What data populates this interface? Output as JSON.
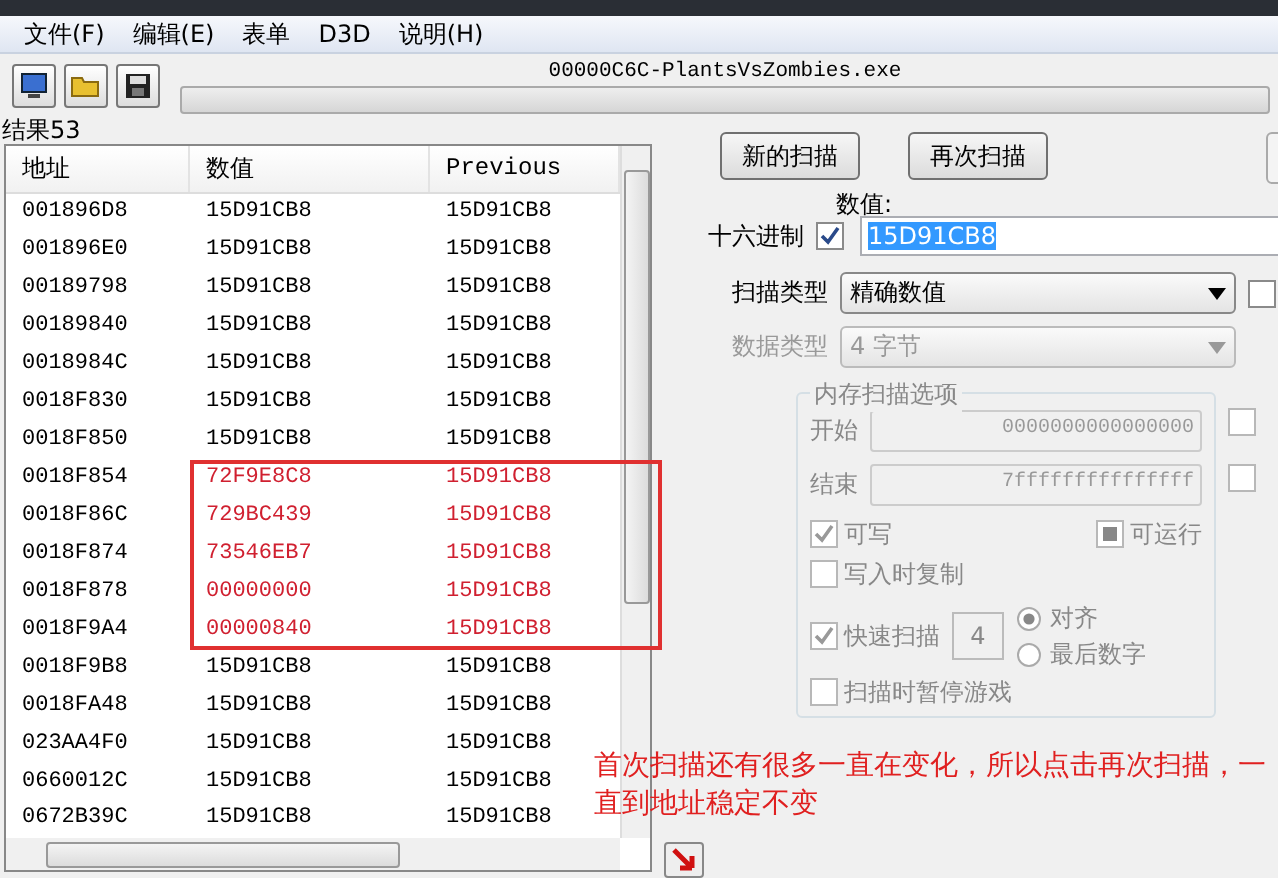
{
  "menu": [
    {
      "label": "文件(F)"
    },
    {
      "label": "编辑(E)"
    },
    {
      "label": "表单"
    },
    {
      "label": "D3D"
    },
    {
      "label": "说明(H)"
    }
  ],
  "toolbar": {
    "process": "00000C6C-PlantsVsZombies.exe",
    "level": 0
  },
  "results": {
    "count_label": "结果53",
    "columns": [
      "地址",
      "数值",
      "Previous"
    ],
    "rows": [
      {
        "address": "001896D8",
        "value": "15D91CB8",
        "previous": "15D91CB8",
        "changed": false
      },
      {
        "address": "001896E0",
        "value": "15D91CB8",
        "previous": "15D91CB8",
        "changed": false
      },
      {
        "address": "00189798",
        "value": "15D91CB8",
        "previous": "15D91CB8",
        "changed": false
      },
      {
        "address": "00189840",
        "value": "15D91CB8",
        "previous": "15D91CB8",
        "changed": false
      },
      {
        "address": "0018984C",
        "value": "15D91CB8",
        "previous": "15D91CB8",
        "changed": false
      },
      {
        "address": "0018F830",
        "value": "15D91CB8",
        "previous": "15D91CB8",
        "changed": false
      },
      {
        "address": "0018F850",
        "value": "15D91CB8",
        "previous": "15D91CB8",
        "changed": false
      },
      {
        "address": "0018F854",
        "value": "72F9E8C8",
        "previous": "15D91CB8",
        "changed": true
      },
      {
        "address": "0018F86C",
        "value": "729BC439",
        "previous": "15D91CB8",
        "changed": true
      },
      {
        "address": "0018F874",
        "value": "73546EB7",
        "previous": "15D91CB8",
        "changed": true
      },
      {
        "address": "0018F878",
        "value": "00000000",
        "previous": "15D91CB8",
        "changed": true
      },
      {
        "address": "0018F9A4",
        "value": "00000840",
        "previous": "15D91CB8",
        "changed": true
      },
      {
        "address": "0018F9B8",
        "value": "15D91CB8",
        "previous": "15D91CB8",
        "changed": false
      },
      {
        "address": "0018FA48",
        "value": "15D91CB8",
        "previous": "15D91CB8",
        "changed": false
      },
      {
        "address": "023AA4F0",
        "value": "15D91CB8",
        "previous": "15D91CB8",
        "changed": false
      },
      {
        "address": "0660012C",
        "value": "15D91CB8",
        "previous": "15D91CB8",
        "changed": false
      },
      {
        "address": "0672B39C",
        "value": "15D91CB8",
        "previous": "15D91CB8",
        "changed": false
      }
    ]
  },
  "scan": {
    "buttons": [
      {
        "label": "新的扫描"
      },
      {
        "label": "再次扫描"
      }
    ],
    "value_label": "数值:",
    "hex": {
      "label": "十六进制",
      "checked": true
    },
    "value": "15D91CB8",
    "scan_type": {
      "label": "扫描类型",
      "value": "精确数值",
      "side_checked": false
    },
    "data_type": {
      "label": "数据类型",
      "value": "4 字节"
    },
    "options": {
      "title": "内存扫描选项",
      "disabled": true,
      "start_label": "开始",
      "start": "0000000000000000",
      "start_side_checked": false,
      "stop_label": "结束",
      "stop": "7fffffffffffffff",
      "stop_side_checked": false,
      "writable": {
        "label": "可写",
        "checked": true
      },
      "executable": {
        "label": "可运行",
        "checked": false,
        "indeterminate": true
      },
      "copy_on_write": {
        "label": "写入时复制",
        "checked": false
      },
      "fast_scan": {
        "label": "快速扫描",
        "checked": true,
        "digits": "4"
      },
      "alignment": [
        {
          "label": "对齐",
          "selected": true
        },
        {
          "label": "最后数字",
          "selected": false
        }
      ],
      "pause": {
        "label": "扫描时暂停游戏",
        "checked": false
      }
    }
  },
  "note": "首次扫描还有很多一直在变化，所以点击再次扫描，一直到地址稳定不变"
}
